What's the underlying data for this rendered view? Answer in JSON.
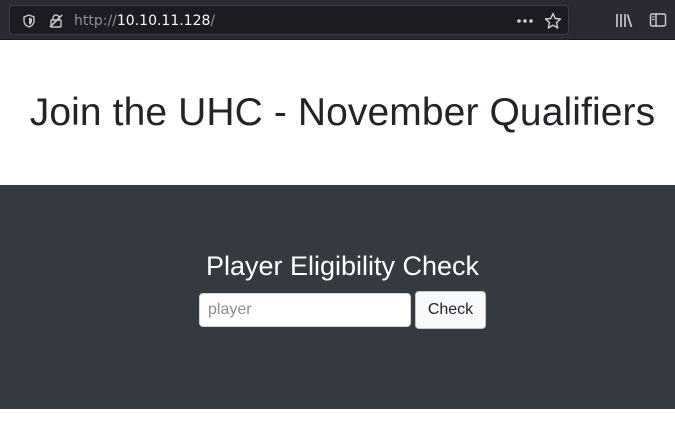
{
  "browser": {
    "url_scheme": "http://",
    "url_host": "10.10.11.128",
    "url_path": "/",
    "icons": {
      "shield": "shield-icon",
      "permissions": "not-secure-icon",
      "page_actions": "ellipsis-icon",
      "bookmark": "star-icon",
      "library": "library-icon",
      "sidebar": "sidebar-icon"
    },
    "colors": {
      "toolbar": "#2b2a33",
      "urlbar": "#1c1b22"
    }
  },
  "header": {
    "title": "Join the UHC - November Qualifiers"
  },
  "panel": {
    "heading": "Player Eligibility Check",
    "input_placeholder": "player",
    "input_value": "",
    "button_label": "Check",
    "colors": {
      "background": "#343a40"
    }
  }
}
